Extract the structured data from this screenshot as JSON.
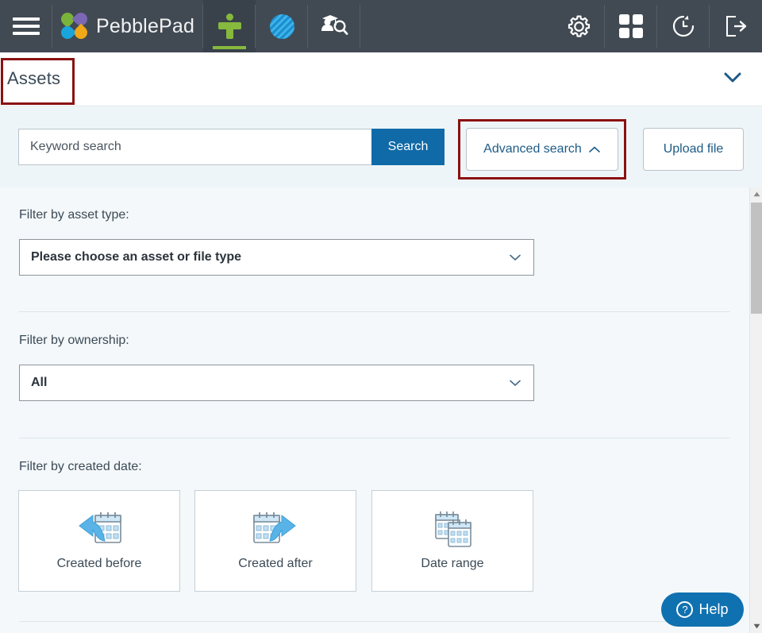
{
  "topnav": {
    "menu_label": "menu",
    "brand_name": "PebblePad",
    "items": [
      {
        "name": "assets-tab",
        "icon": "person-icon",
        "label": "Assets",
        "active": true
      },
      {
        "name": "atlas-tab",
        "icon": "atlas-circle-icon",
        "label": "ATLAS",
        "active": false
      },
      {
        "name": "find-learner-tab",
        "icon": "graduate-search-icon",
        "label": "Find learner",
        "active": false
      }
    ],
    "right_items": [
      {
        "name": "settings-button",
        "icon": "gear-icon",
        "label": "Settings"
      },
      {
        "name": "apps-button",
        "icon": "grid-icon",
        "label": "Apps"
      },
      {
        "name": "history-button",
        "icon": "history-clock-icon",
        "label": "Recent activity"
      },
      {
        "name": "logout-button",
        "icon": "logout-icon",
        "label": "Log out"
      }
    ]
  },
  "titlebar": {
    "title": "Assets",
    "chevron": "chevron-down-icon"
  },
  "search": {
    "placeholder": "Keyword search",
    "value": "",
    "search_button": "Search",
    "advanced_button": "Advanced search",
    "advanced_chevron": "chevron-up-icon",
    "upload_button": "Upload file"
  },
  "filters": {
    "asset_type": {
      "label": "Filter by asset type:",
      "value": "Please choose an asset or file type",
      "chevron": "chevron-down-icon"
    },
    "ownership": {
      "label": "Filter by ownership:",
      "value": "All",
      "chevron": "chevron-down-icon"
    },
    "created_date": {
      "label": "Filter by created date:",
      "cards": [
        {
          "label": "Created before",
          "icon": "calendar-back-arrow-icon"
        },
        {
          "label": "Created after",
          "icon": "calendar-forward-arrow-icon"
        },
        {
          "label": "Date range",
          "icon": "calendar-range-icon"
        }
      ]
    }
  },
  "help": {
    "label": "Help",
    "icon": "question-mark-icon"
  },
  "scrollbar": {
    "up_icon": "triangle-up-icon",
    "down_icon": "triangle-down-icon"
  },
  "colors": {
    "nav_bg": "#414a53",
    "accent_green": "#86b93d",
    "accent_blue": "#106aa8",
    "highlight_red": "#8b1111",
    "panel_bg": "#f4f8fa"
  }
}
